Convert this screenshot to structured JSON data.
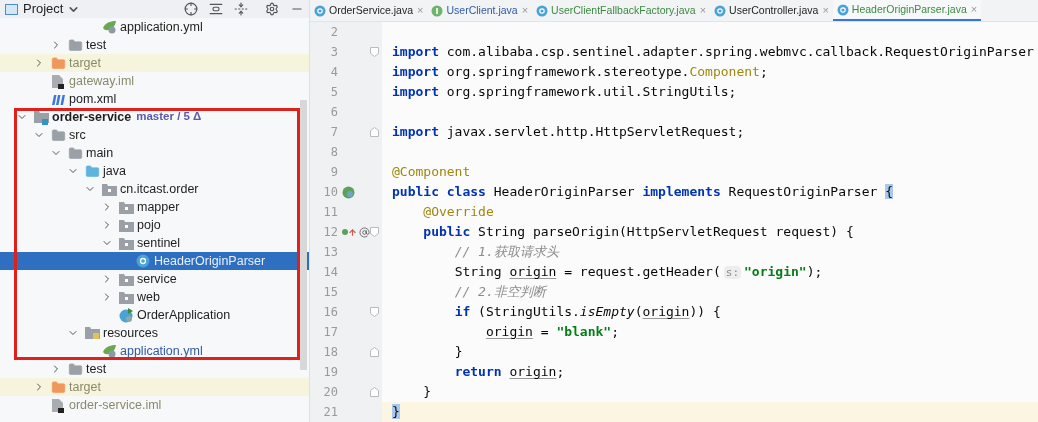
{
  "project_panel": {
    "title": "Project",
    "tree": [
      {
        "children": [
          {
            "children": [
              {
                "children": [
                  {
                    "children": [
                      {
                        "label": "application.yml",
                        "kind": "yml",
                        "selected": false
                      }
                    ]
                  }
                ]
              },
              {
                "label": "test",
                "kind": "folder",
                "expanded": false,
                "selected": false
              }
            ]
          },
          {
            "label": "target",
            "kind": "excluded_folder",
            "expanded": false,
            "color": "#8a8a6a",
            "selected": false
          },
          {
            "label": "gateway.iml",
            "kind": "iml",
            "color": "#8a8a6a",
            "selected": false
          },
          {
            "label": "pom.xml",
            "kind": "maven",
            "selected": false
          }
        ]
      },
      {
        "label": "order-service",
        "kind": "module",
        "expanded": true,
        "selected": false,
        "branch": "master / 5 Δ",
        "children": [
          {
            "label": "src",
            "kind": "folder",
            "expanded": true,
            "selected": false,
            "children": [
              {
                "label": "main",
                "kind": "folder",
                "expanded": true,
                "selected": false,
                "children": [
                  {
                    "label": "java",
                    "kind": "source_folder",
                    "expanded": true,
                    "selected": false,
                    "children": [
                      {
                        "label": "cn.itcast.order",
                        "kind": "package",
                        "expanded": true,
                        "selected": false,
                        "children": [
                          {
                            "label": "mapper",
                            "kind": "package",
                            "expanded": false,
                            "selected": false
                          },
                          {
                            "label": "pojo",
                            "kind": "package",
                            "expanded": false,
                            "selected": false
                          },
                          {
                            "label": "sentinel",
                            "kind": "package",
                            "expanded": true,
                            "selected": false,
                            "children": [
                              {
                                "label": "HeaderOriginParser",
                                "kind": "class",
                                "selected": true
                              }
                            ]
                          },
                          {
                            "label": "service",
                            "kind": "package",
                            "expanded": false,
                            "selected": false
                          },
                          {
                            "label": "web",
                            "kind": "package",
                            "expanded": false,
                            "selected": false
                          },
                          {
                            "label": "OrderApplication",
                            "kind": "spring_class",
                            "selected": false
                          }
                        ]
                      }
                    ]
                  },
                  {
                    "label": "resources",
                    "kind": "resources",
                    "expanded": true,
                    "selected": false,
                    "children": [
                      {
                        "label": "application.yml",
                        "kind": "yml",
                        "color": "#2f5aa8",
                        "selected": false
                      }
                    ]
                  }
                ]
              },
              {
                "label": "test",
                "kind": "folder",
                "expanded": false,
                "selected": false
              }
            ]
          },
          {
            "label": "target",
            "kind": "excluded_folder",
            "expanded": false,
            "color": "#8a8a6a",
            "selected": false
          },
          {
            "label": "order-service.iml",
            "kind": "iml",
            "color": "#8a8a6a",
            "selected": false
          }
        ]
      }
    ]
  },
  "tabs": [
    {
      "label": "OrderService.java",
      "kind": "class",
      "selected": false,
      "close": "×"
    },
    {
      "label": "UserClient.java",
      "kind": "interface",
      "color": "#2f5aa8",
      "selected": false,
      "close": "×"
    },
    {
      "label": "UserClientFallbackFactory.java",
      "kind": "class",
      "color": "#3b8a3e",
      "selected": false,
      "close": "×"
    },
    {
      "label": "UserController.java",
      "kind": "class",
      "selected": false,
      "close": "×"
    },
    {
      "label": "HeaderOriginParser.java",
      "kind": "class",
      "color": "#3b8a3e",
      "selected": true,
      "close": "×"
    }
  ],
  "editor": {
    "lines": [
      {
        "number": "2"
      },
      {
        "number": "3",
        "fold": {
          "kind": "start"
        },
        "tokens": [
          {
            "kind": "keyword",
            "text": "import"
          },
          {
            "kind": "plain",
            "text": " com.alibaba.csp.sentinel.adapter.spring.webmvc.callback.RequestOriginParser"
          }
        ]
      },
      {
        "number": "4",
        "tokens": [
          {
            "kind": "keyword",
            "text": "import"
          },
          {
            "kind": "plain",
            "text": " org.springframework.stereotype."
          },
          {
            "kind": "annotation",
            "text": "Component"
          },
          {
            "kind": "plain",
            "text": ";"
          }
        ]
      },
      {
        "number": "5",
        "tokens": [
          {
            "kind": "keyword",
            "text": "import"
          },
          {
            "kind": "plain",
            "text": " org.springframework.util.StringUtils;"
          }
        ]
      },
      {
        "number": "6"
      },
      {
        "number": "7",
        "fold": {
          "kind": "end"
        },
        "tokens": [
          {
            "kind": "keyword",
            "text": "import"
          },
          {
            "kind": "plain",
            "text": " javax.servlet.http.HttpServletRequest;"
          }
        ]
      },
      {
        "number": "8"
      },
      {
        "number": "9",
        "tokens": [
          {
            "kind": "annotation",
            "text": "@Component"
          }
        ]
      },
      {
        "number": "10",
        "gutter": [
          {
            "kind": "bean"
          }
        ],
        "tokens": [
          {
            "kind": "keyword",
            "text": "public class"
          },
          {
            "kind": "plain",
            "text": " HeaderOriginParser "
          },
          {
            "kind": "keyword",
            "text": "implements"
          },
          {
            "kind": "plain",
            "text": " RequestOriginParser "
          },
          {
            "kind": "brace_match",
            "text": "{"
          }
        ]
      },
      {
        "number": "11",
        "tokens": [
          {
            "kind": "annotation",
            "text": "    @Override"
          }
        ]
      },
      {
        "number": "12",
        "gutter": [
          {
            "kind": "implements"
          },
          {
            "kind": "at"
          }
        ],
        "fold": {
          "kind": "start"
        },
        "tokens": [
          {
            "kind": "keyword",
            "text": "    public"
          },
          {
            "kind": "plain",
            "text": " String parseOrigin(HttpServletRequest request) {"
          }
        ]
      },
      {
        "number": "13",
        "tokens": [
          {
            "kind": "comment",
            "text": "        // 1.获取请求头"
          }
        ]
      },
      {
        "number": "14",
        "tokens": [
          {
            "kind": "plain",
            "text": "        String"
          },
          {
            "kind": "var",
            "text": " origin"
          },
          {
            "kind": "plain",
            "text": " = request.getHeader("
          },
          {
            "kind": "hint",
            "text": "s:"
          },
          {
            "kind": "string",
            "text": "\"origin\""
          },
          {
            "kind": "plain",
            "text": ");"
          }
        ]
      },
      {
        "number": "15",
        "tokens": [
          {
            "kind": "comment",
            "text": "        // 2.非空判断"
          }
        ]
      },
      {
        "number": "16",
        "fold": {
          "kind": "start"
        },
        "tokens": [
          {
            "kind": "keyword",
            "text": "        if"
          },
          {
            "kind": "plain",
            "text": " (StringUtils."
          },
          {
            "kind": "method_static",
            "text": "isEmpty"
          },
          {
            "kind": "plain",
            "text": "("
          },
          {
            "kind": "var",
            "text": "origin"
          },
          {
            "kind": "plain",
            "text": ")) {"
          }
        ]
      },
      {
        "number": "17",
        "tokens": [
          {
            "kind": "var",
            "text": "            origin"
          },
          {
            "kind": "plain",
            "text": " = "
          },
          {
            "kind": "string",
            "text": "\"blank\""
          },
          {
            "kind": "plain",
            "text": ";"
          }
        ]
      },
      {
        "number": "18",
        "fold": {
          "kind": "end"
        },
        "tokens": [
          {
            "kind": "plain",
            "text": "        }"
          }
        ]
      },
      {
        "number": "19",
        "tokens": [
          {
            "kind": "keyword",
            "text": "        return"
          },
          {
            "kind": "var",
            "text": " origin"
          },
          {
            "kind": "plain",
            "text": ";"
          }
        ]
      },
      {
        "number": "20",
        "fold": {
          "kind": "end"
        },
        "tokens": [
          {
            "kind": "plain",
            "text": "    }"
          }
        ]
      },
      {
        "number": "21",
        "current": true,
        "tokens": [
          {
            "kind": "brace_match",
            "text": "}"
          }
        ]
      }
    ]
  }
}
